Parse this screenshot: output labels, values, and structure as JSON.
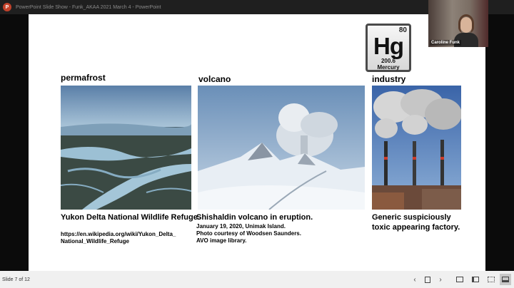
{
  "window": {
    "title": "PowerPoint Slide Show  -  Funk_AKAA 2021 March 4  -  PowerPoint"
  },
  "app_icon": {
    "letter": "P"
  },
  "element_tile": {
    "number": "80",
    "symbol": "Hg",
    "mass": "200.6",
    "name": "Mercury"
  },
  "columns": [
    {
      "label": "permafrost",
      "caption": "Yukon Delta National Wildlife Refuge.",
      "source_line1": "https://en.wikipedia.org/wiki/Yukon_Delta_",
      "source_line2": "National_Wildlife_Refuge"
    },
    {
      "label": "volcano",
      "caption": "Shishaldin volcano in eruption.",
      "detail_line1": "January 19, 2020, Unimak Island.",
      "detail_line2": "Photo courtesy of Woodsen Saunders.",
      "detail_line3": "AVO image library."
    },
    {
      "label": "industry",
      "caption_line1": "Generic suspiciously",
      "caption_line2": "toxic appearing factory."
    }
  ],
  "presenter": {
    "name": "Caroline Funk"
  },
  "statusbar": {
    "slide_counter": "Slide 7 of 12"
  },
  "colors": {
    "accent": "#c4422b",
    "sky": "#6f8fb5",
    "water": "#8fb3cc"
  }
}
